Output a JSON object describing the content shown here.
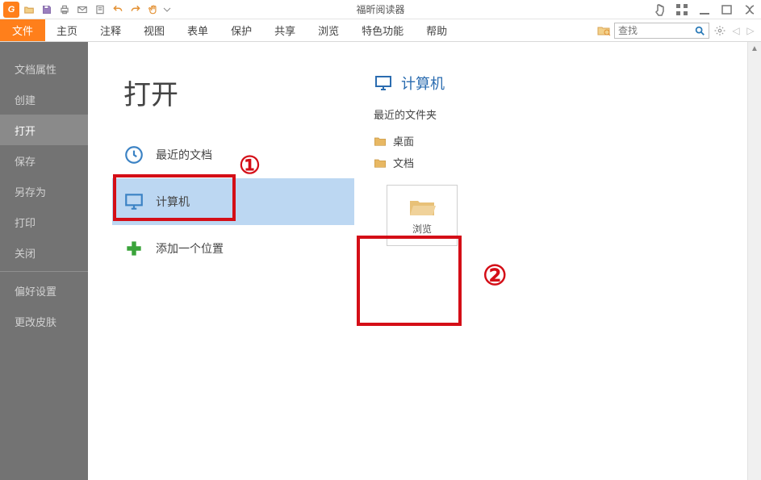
{
  "app_title": "福昕阅读器",
  "ribbon": {
    "file": "文件",
    "tabs": [
      "主页",
      "注释",
      "视图",
      "表单",
      "保护",
      "共享",
      "浏览",
      "特色功能",
      "帮助"
    ]
  },
  "search": {
    "placeholder": "查找"
  },
  "sidebar": {
    "items": [
      {
        "label": "文档属性",
        "selected": false
      },
      {
        "label": "创建",
        "selected": false
      },
      {
        "label": "打开",
        "selected": true
      },
      {
        "label": "保存",
        "selected": false
      },
      {
        "label": "另存为",
        "selected": false
      },
      {
        "label": "打印",
        "selected": false
      },
      {
        "label": "关闭",
        "selected": false
      }
    ],
    "bottom": [
      {
        "label": "偏好设置"
      },
      {
        "label": "更改皮肤"
      }
    ]
  },
  "page": {
    "title": "打开",
    "options": [
      {
        "label": "最近的文档",
        "icon": "clock",
        "selected": false
      },
      {
        "label": "计算机",
        "icon": "monitor",
        "selected": true
      },
      {
        "label": "添加一个位置",
        "icon": "plus",
        "selected": false
      }
    ]
  },
  "right": {
    "heading": "计算机",
    "subheading": "最近的文件夹",
    "folders": [
      "桌面",
      "文档"
    ],
    "browse_label": "浏览"
  }
}
